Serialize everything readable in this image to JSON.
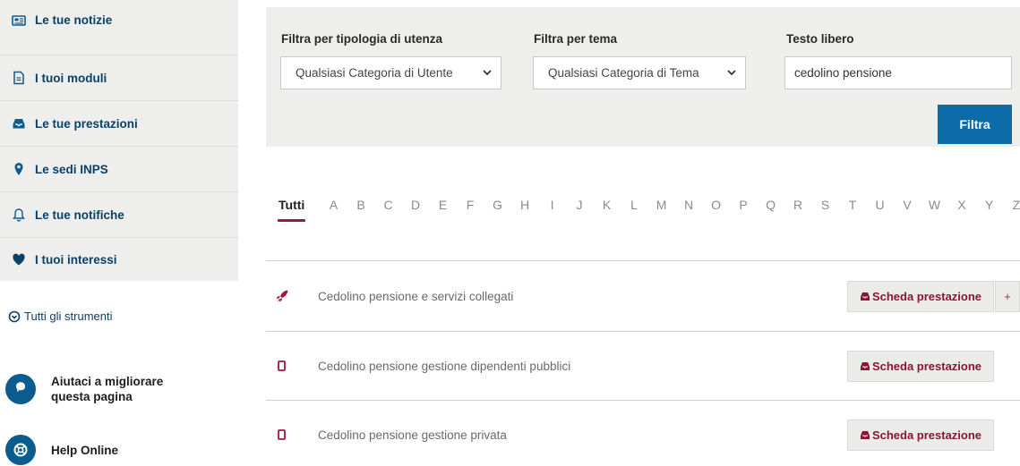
{
  "sidebar": {
    "items": [
      {
        "label": "Le tue notizie",
        "icon": "news-icon"
      },
      {
        "label": "I tuoi moduli",
        "icon": "document-icon"
      },
      {
        "label": "Le tue prestazioni",
        "icon": "inbox-icon"
      },
      {
        "label": "Le sedi INPS",
        "icon": "location-pin-icon"
      },
      {
        "label": "Le tue notifiche",
        "icon": "bell-icon"
      },
      {
        "label": "I tuoi interessi",
        "icon": "heart-icon"
      }
    ],
    "tools_link": "Tutti gli strumenti",
    "feedback": {
      "line1": "Aiutaci a migliorare",
      "line2": "questa pagina"
    },
    "help": "Help Online"
  },
  "filters": {
    "user_type": {
      "label": "Filtra per tipologia di utenza",
      "value": "Qualsiasi Categoria di Utente"
    },
    "theme": {
      "label": "Filtra per tema",
      "value": "Qualsiasi Categoria di Tema"
    },
    "free_text": {
      "label": "Testo libero",
      "value": "cedolino pensione"
    },
    "button": "Filtra"
  },
  "alphabet": [
    "Tutti",
    "A",
    "B",
    "C",
    "D",
    "E",
    "F",
    "G",
    "H",
    "I",
    "J",
    "K",
    "L",
    "M",
    "N",
    "O",
    "P",
    "Q",
    "R",
    "S",
    "T",
    "U",
    "V",
    "W",
    "X",
    "Y",
    "Z"
  ],
  "results": [
    {
      "title": "Cedolino pensione e servizi collegati",
      "icon": "rocket-icon",
      "button": "Scheda prestazione",
      "extra": "+"
    },
    {
      "title": "Cedolino pensione gestione dipendenti pubblici",
      "icon": "document-icon",
      "button": "Scheda prestazione"
    },
    {
      "title": "Cedolino pensione gestione privata",
      "icon": "document-icon",
      "button": "Scheda prestazione"
    }
  ],
  "colors": {
    "brand_blue": "#0b4166",
    "button_blue": "#0b6ca8",
    "accent": "#9b1a3e",
    "panel": "#eeeeec"
  }
}
